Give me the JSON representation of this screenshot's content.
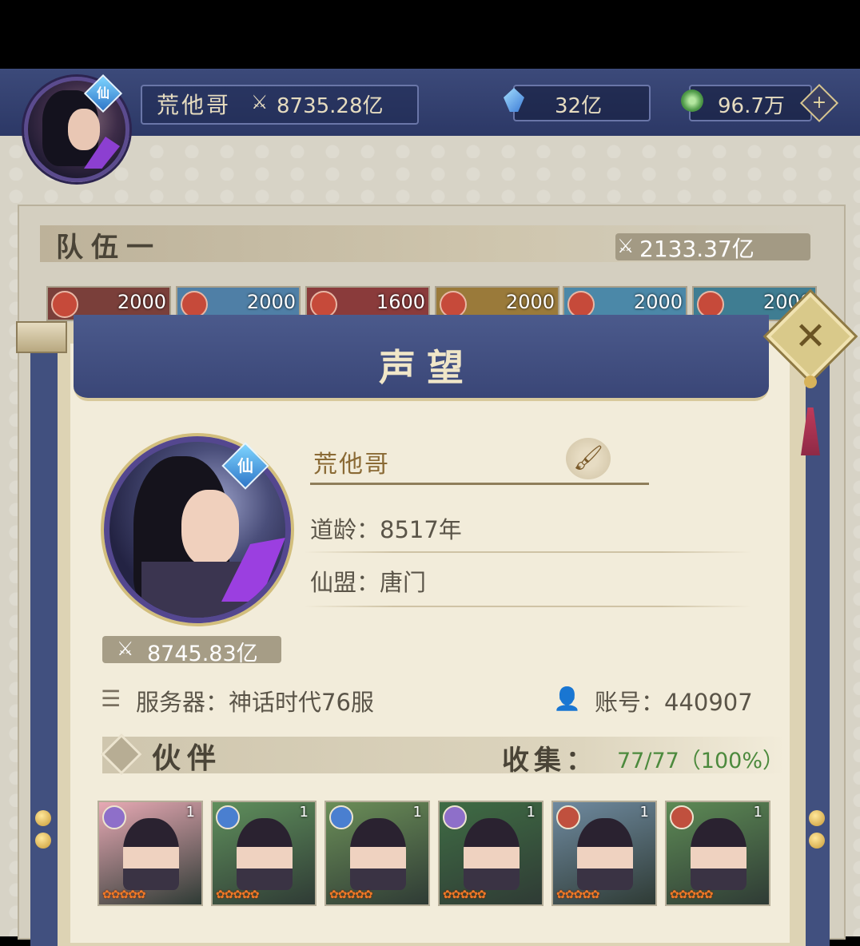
{
  "top": {
    "player_name": "荒他哥",
    "power": "8735.28亿",
    "crystal": "32亿",
    "jade": "96.7万",
    "rank_badge": "仙",
    "add_icon": "+"
  },
  "team": {
    "title": "队伍一",
    "power": "2133.37亿",
    "levels": [
      "2000",
      "2000",
      "1600",
      "2000",
      "2000",
      "2000"
    ]
  },
  "modal": {
    "title": "声望",
    "close_symbol": "✕",
    "name": "荒他哥",
    "rank_badge": "仙",
    "dao_age": "道龄：8517年",
    "alliance": "仙盟：唐门",
    "power": "8745.83亿",
    "server": "服务器：神话时代76服",
    "account": "账号：440907"
  },
  "partners": {
    "title": "伙伴",
    "collect_label": "收集：",
    "collect_value": "77/77（100%）",
    "cards": [
      {
        "level": "1",
        "stars": "✿✿✿✿✿",
        "element": "spirit",
        "color": "#8e6fc9",
        "bg": "#e7a9b4"
      },
      {
        "level": "1",
        "stars": "✿✿✿✿✿",
        "element": "wind",
        "color": "#4a7fd0",
        "bg": "#5f8f5c"
      },
      {
        "level": "1",
        "stars": "✿✿✿✿✿",
        "element": "wind",
        "color": "#4a7fd0",
        "bg": "#6b8e58"
      },
      {
        "level": "1",
        "stars": "✿✿✿✿✿",
        "element": "spirit",
        "color": "#8e6fc9",
        "bg": "#3f6c44"
      },
      {
        "level": "1",
        "stars": "✿✿✿✿✿",
        "element": "fire",
        "color": "#c0503e",
        "bg": "#6f8aa0"
      },
      {
        "level": "1",
        "stars": "✿✿✿✿✿",
        "element": "fire",
        "color": "#c0503e",
        "bg": "#5d8a55"
      }
    ]
  },
  "colors": {
    "header_blue": "#3a4677",
    "paper": "#f2ecda",
    "gold": "#d8c99c",
    "collect_green": "#4c8a3d"
  }
}
